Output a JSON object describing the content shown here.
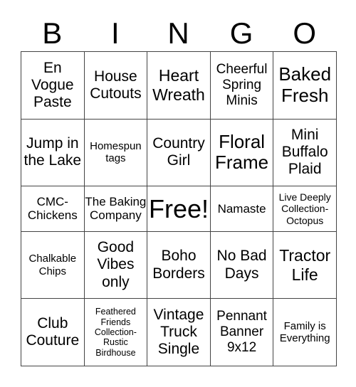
{
  "header": [
    "B",
    "I",
    "N",
    "G",
    "O"
  ],
  "board": [
    [
      "En Vogue Paste",
      "House Cutouts",
      "Heart Wreath",
      "Cheerful Spring Minis",
      "Baked Fresh"
    ],
    [
      "Jump in the Lake",
      "Homespun tags",
      "Country Girl",
      "Floral Frame",
      "Mini Buffalo Plaid"
    ],
    [
      "CMC-Chickens",
      "The Baking Company",
      "Free!",
      "Namaste",
      "Live Deeply Collection-Octopus"
    ],
    [
      "Chalkable Chips",
      "Good Vibes only",
      "Boho Borders",
      "No Bad Days",
      "Tractor Life"
    ],
    [
      "Club Couture",
      "Feathered Friends Collection-Rustic Birdhouse",
      "Vintage Truck Single",
      "Pennant Banner 9x12",
      "Family is Everything"
    ]
  ]
}
